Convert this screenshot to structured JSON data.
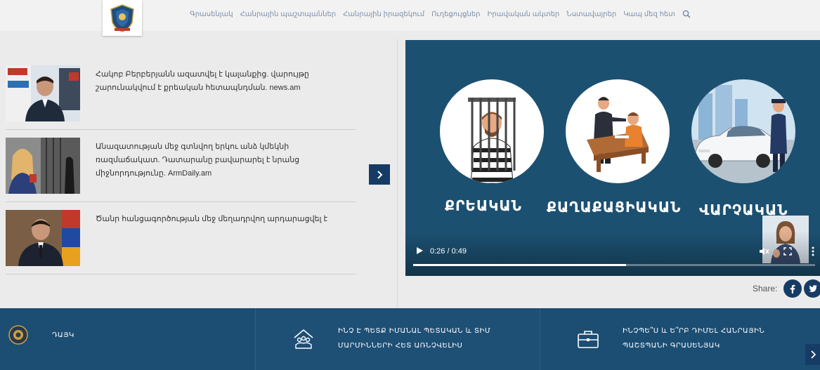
{
  "header": {
    "logo_icon": "police-emblem-icon",
    "nav": [
      "Գրասենյակ",
      "Հանրային պաշտպաններ",
      "Հանրային իրազեկում",
      "Ուղեցույցներ",
      "Իրավական ակտեր",
      "Նստավայրեր",
      "Կապ մեզ հետ"
    ],
    "search_icon": "search-icon"
  },
  "news": [
    {
      "title": "Հակոբ Բերբերյանն ազատվել է կալանքից. վարույթը շարունակվում է քրեական հետապնդման. news.am"
    },
    {
      "title": "Անազատության մեջ գտնվող երկու անձ կմեկնի ռազմաճակատ. Դատարանը բավարարել է նրանց միջնորդությունը. ArmDaily.am"
    },
    {
      "title": "Ծանր հանցագործության մեջ մեղադրվող արդարացվել է"
    }
  ],
  "video": {
    "categories": [
      "ՔՐԵԱԿԱՆ",
      "ՔԱՂԱՔԱՑԻԱԿԱՆ",
      "ՎԱՐՉԱԿԱՆ"
    ],
    "time": "0:26 / 0:49",
    "progress": 0.53
  },
  "share": {
    "label": "Share:",
    "icons": [
      "facebook-icon",
      "twitter-icon"
    ]
  },
  "footer": [
    {
      "icon": "emblem-icon",
      "label": "ԴԱՅԿ"
    },
    {
      "icon": "people-house-icon",
      "label": "ԻՆՉ Է ՊԵՏՔ ԻՄԱՆԱԼ ՊԵՏԱԿԱՆ և ՏԻՄ ՄԱՐՄԻՆՆԵՐԻ ՀԵՏ ԱՌՆՉՎԵԼԻՍ"
    },
    {
      "icon": "briefcase-icon",
      "label": "ԻՆՉՊԵ՞Ս և Ե՞ՐԲ ԴԻՄԵԼ ՀԱՆՐԱՅԻՆ ՊԱՇՏՊԱՆԻ ԳՐԱՍԵՆՅԱԿ"
    }
  ],
  "colors": {
    "navy": "#163c66",
    "video_bg": "#1c5071",
    "footer_bg": "#1c4d72",
    "nav_text": "#7b8ea8"
  }
}
